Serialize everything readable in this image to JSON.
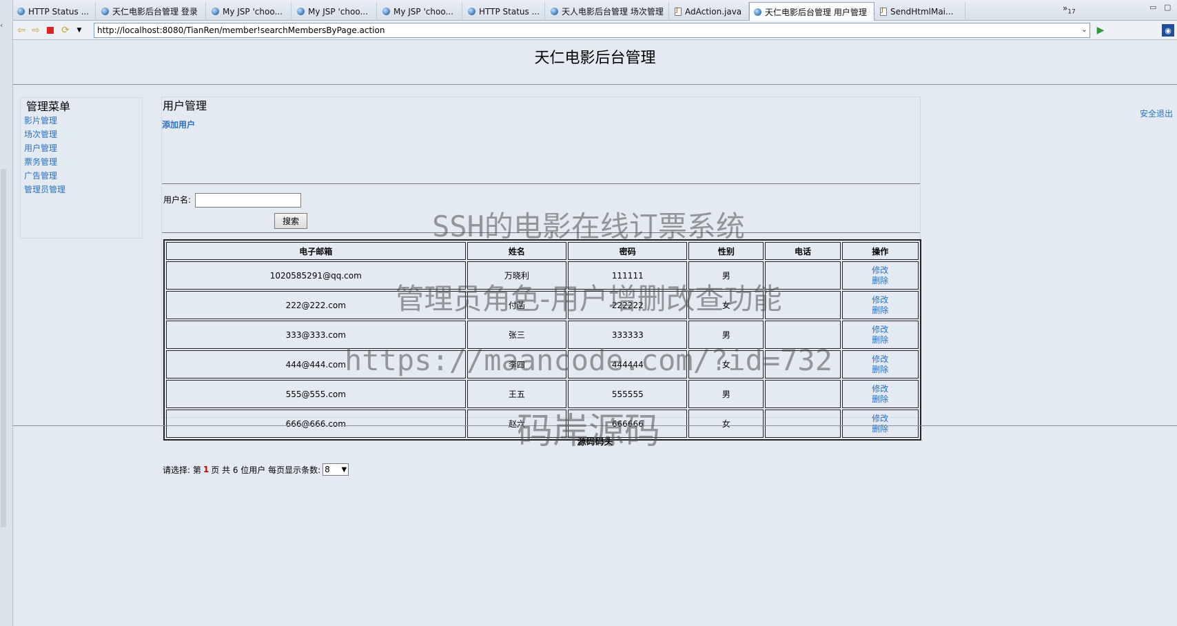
{
  "browser": {
    "tabs": [
      {
        "label": "HTTP Status ...",
        "icon": "globe-icon"
      },
      {
        "label": "天仁电影后台管理 登录",
        "icon": "globe-icon"
      },
      {
        "label": "My JSP 'choo...",
        "icon": "globe-icon"
      },
      {
        "label": "My JSP 'choo...",
        "icon": "globe-icon"
      },
      {
        "label": "My JSP 'choo...",
        "icon": "globe-icon"
      },
      {
        "label": "HTTP Status ...",
        "icon": "globe-icon"
      },
      {
        "label": "天人电影后台管理 场次管理",
        "icon": "globe-icon"
      },
      {
        "label": "AdAction.java",
        "icon": "java-file-icon"
      },
      {
        "label": "天仁电影后台管理 用户管理",
        "icon": "globe-icon"
      },
      {
        "label": "SendHtmlMai...",
        "icon": "java-file-icon"
      }
    ],
    "more_tabs": "»",
    "more_tabs_count": "17",
    "url": "http://localhost:8080/TianRen/member!searchMembersByPage.action"
  },
  "page": {
    "title": "天仁电影后台管理",
    "logout": "安全退出",
    "menu": {
      "title": "管理菜单",
      "items": [
        "影片管理",
        "场次管理",
        "用户管理",
        "票务管理",
        "广告管理",
        "管理员管理"
      ]
    },
    "content": {
      "title": "用户管理",
      "add_user": "添加用户",
      "search_label": "用户名:",
      "search_button": "搜索",
      "table": {
        "headers": [
          "电子邮箱",
          "姓名",
          "密码",
          "性别",
          "电话",
          "操作"
        ],
        "edit_label": "修改",
        "delete_label": "删除",
        "rows": [
          [
            "1020585291@qq.com",
            "万晓利",
            "111111",
            "男",
            ""
          ],
          [
            "222@222.com",
            "付菡",
            "222222",
            "女",
            ""
          ],
          [
            "333@333.com",
            "张三",
            "333333",
            "男",
            ""
          ],
          [
            "444@444.com",
            "李四",
            "444444",
            "女",
            ""
          ],
          [
            "555@555.com",
            "王五",
            "555555",
            "男",
            ""
          ],
          [
            "666@666.com",
            "赵六",
            "666666",
            "女",
            ""
          ]
        ]
      },
      "pager": {
        "prefix": "请选择: 第",
        "current": "1",
        "middle": "页 共 6 位用户 每页显示条数:",
        "page_size": "8"
      }
    },
    "footer": "源码码头"
  },
  "watermark": {
    "line1": "SSH的电影在线订票系统",
    "line2": "管理员角色-用户增删改查功能",
    "line3": "https://maancode.com/?id=732",
    "line4": "码岸源码"
  }
}
